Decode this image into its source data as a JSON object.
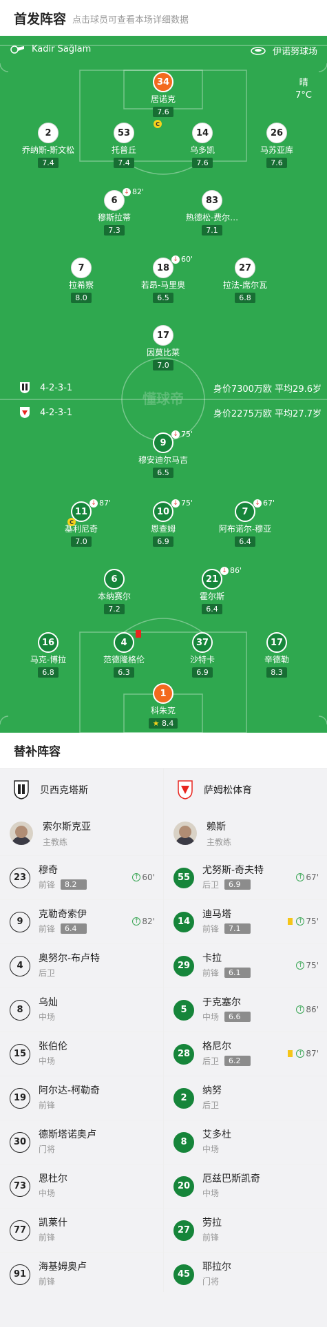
{
  "header": {
    "title": "首发阵容",
    "subtitle": "点击球员可查看本场详细数据"
  },
  "pitch_info": {
    "referee": "Kadir Sağlam",
    "stadium": "伊诺努球场",
    "weather": "晴",
    "temperature": "7°C",
    "watermark": "懂球帝"
  },
  "home": {
    "formation": "4-2-3-1",
    "value": "身价7300万欧 平均29.6岁"
  },
  "away": {
    "formation": "4-2-3-1",
    "value": "身价2275万欧 平均27.7岁"
  },
  "home_players": [
    {
      "num": "34",
      "name": "居诺克",
      "rating": "7.6",
      "captain": "C"
    },
    {
      "num": "2",
      "name": "乔纳斯-斯文松",
      "rating": "7.4"
    },
    {
      "num": "53",
      "name": "托普丘",
      "rating": "7.4"
    },
    {
      "num": "14",
      "name": "乌多凯",
      "rating": "7.6"
    },
    {
      "num": "26",
      "name": "马苏亚库",
      "rating": "7.6"
    },
    {
      "num": "6",
      "name": "穆斯拉蒂",
      "rating": "7.3",
      "sub": "82'"
    },
    {
      "num": "83",
      "name": "热德松-费尔…",
      "rating": "7.1"
    },
    {
      "num": "7",
      "name": "拉希察",
      "rating": "8.0"
    },
    {
      "num": "18",
      "name": "若昂-马里奥",
      "rating": "6.5",
      "sub": "60'"
    },
    {
      "num": "27",
      "name": "拉法-席尔瓦",
      "rating": "6.8"
    },
    {
      "num": "17",
      "name": "因莫比莱",
      "rating": "7.0"
    }
  ],
  "away_players": [
    {
      "num": "9",
      "name": "穆安迪尔马吉",
      "rating": "6.5",
      "sub": "75'"
    },
    {
      "num": "11",
      "name": "基利尼奇",
      "rating": "7.0",
      "sub": "87'",
      "captain": "C"
    },
    {
      "num": "10",
      "name": "恩查姆",
      "rating": "6.9",
      "sub": "75'"
    },
    {
      "num": "7",
      "name": "阿布诺尔-穆亚",
      "rating": "6.4",
      "sub": "67'"
    },
    {
      "num": "6",
      "name": "本纳赛尔",
      "rating": "7.2"
    },
    {
      "num": "21",
      "name": "霍尔斯",
      "rating": "6.4",
      "sub": "86'"
    },
    {
      "num": "16",
      "name": "马克-博拉",
      "rating": "6.8"
    },
    {
      "num": "4",
      "name": "范德隆格伦",
      "rating": "6.3"
    },
    {
      "num": "37",
      "name": "沙特卡",
      "rating": "6.9"
    },
    {
      "num": "17",
      "name": "辛德勒",
      "rating": "8.3"
    },
    {
      "num": "1",
      "name": "科朱克",
      "rating": "8.4",
      "star": "★"
    }
  ],
  "bench": {
    "title": "替补阵容",
    "left": {
      "team": "贝西克塔斯",
      "coach": {
        "name": "索尔斯克亚",
        "role": "主教练"
      },
      "players": [
        {
          "num": "23",
          "name": "穆奇",
          "pos": "前锋",
          "rating": "8.2",
          "in": "60'"
        },
        {
          "num": "9",
          "name": "克勒奇索伊",
          "pos": "前锋",
          "rating": "6.4",
          "in": "82'"
        },
        {
          "num": "4",
          "name": "奥努尔-布卢特",
          "pos": "后卫"
        },
        {
          "num": "8",
          "name": "乌灿",
          "pos": "中场"
        },
        {
          "num": "15",
          "name": "张伯伦",
          "pos": "中场"
        },
        {
          "num": "19",
          "name": "阿尔达-柯勒奇",
          "pos": "前锋"
        },
        {
          "num": "30",
          "name": "德斯塔诺奥卢",
          "pos": "门将"
        },
        {
          "num": "73",
          "name": "恩杜尔",
          "pos": "中场"
        },
        {
          "num": "77",
          "name": "凯莱什",
          "pos": "前锋"
        },
        {
          "num": "91",
          "name": "海基姆奥卢",
          "pos": "前锋"
        }
      ]
    },
    "right": {
      "team": "萨姆松体育",
      "coach": {
        "name": "赖斯",
        "role": "主教练"
      },
      "players": [
        {
          "num": "55",
          "name": "尤努斯-奇夫特",
          "pos": "后卫",
          "rating": "6.9",
          "in": "67'"
        },
        {
          "num": "14",
          "name": "迪马塔",
          "pos": "前锋",
          "rating": "7.1",
          "in": "75'",
          "yellow": true
        },
        {
          "num": "29",
          "name": "卡拉",
          "pos": "前锋",
          "rating": "6.1",
          "in": "75'"
        },
        {
          "num": "5",
          "name": "于克塞尔",
          "pos": "中场",
          "rating": "6.6",
          "in": "86'"
        },
        {
          "num": "28",
          "name": "格尼尔",
          "pos": "后卫",
          "rating": "6.2",
          "in": "87'",
          "yellow": true
        },
        {
          "num": "2",
          "name": "纳努",
          "pos": "后卫"
        },
        {
          "num": "8",
          "name": "艾多杜",
          "pos": "中场"
        },
        {
          "num": "20",
          "name": "厄兹巴斯凯奇",
          "pos": "中场"
        },
        {
          "num": "27",
          "name": "劳拉",
          "pos": "前锋"
        },
        {
          "num": "45",
          "name": "耶拉尔",
          "pos": "门将"
        }
      ]
    }
  },
  "colors": {
    "pitch": "#2fa84f",
    "home_disc": "#ffffff",
    "away_disc": "#16853a",
    "keeper": "#f36a1e"
  }
}
